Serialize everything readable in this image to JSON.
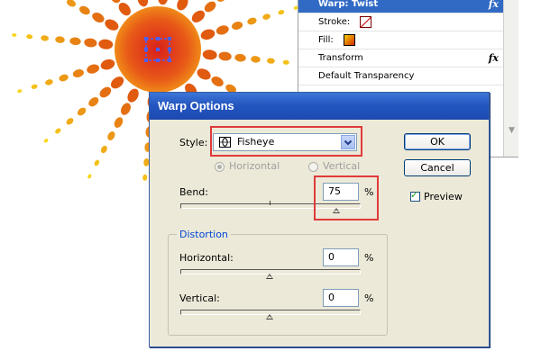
{
  "appearance_panel": {
    "rows": [
      {
        "label": "Warp: Twist",
        "has_fx": true,
        "selected": true
      },
      {
        "label": "Stroke:",
        "swatch": "stroke"
      },
      {
        "label": "Fill:",
        "swatch": "fill"
      },
      {
        "label": "Transform",
        "has_fx": true
      },
      {
        "label": "Default Transparency"
      }
    ],
    "fx_glyph": "fx"
  },
  "dialog": {
    "title": "Warp Options",
    "style_label": "Style:",
    "style_value": "Fisheye",
    "style_icon": "fisheye-icon",
    "orientation": {
      "horizontal_label": "Horizontal",
      "vertical_label": "Vertical",
      "selected": "horizontal",
      "enabled": false
    },
    "bend": {
      "label": "Bend:",
      "value": "75",
      "unit": "%",
      "fraction": 0.875
    },
    "distortion": {
      "group_label": "Distortion",
      "horizontal": {
        "label": "Horizontal:",
        "value": "0",
        "unit": "%",
        "fraction": 0.5
      },
      "vertical": {
        "label": "Vertical:",
        "value": "0",
        "unit": "%",
        "fraction": 0.5
      }
    },
    "ok_label": "OK",
    "cancel_label": "Cancel",
    "preview_label": "Preview",
    "preview_checked": true
  },
  "colors": {
    "title_bar": "#2456c0",
    "dialog_bg": "#ece9d8",
    "callout": "#e03a3a",
    "selection": "#316ac5",
    "ray_inner": "#e05a10",
    "ray_outer": "#f8d51a",
    "center": "#e03c1c"
  }
}
